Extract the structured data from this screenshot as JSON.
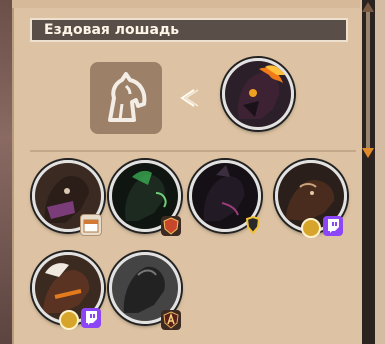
{
  "panel": {
    "title": "Ездовая лошадь"
  },
  "featured": {
    "icon": "horse-head-icon",
    "selected_mount": "fire-mane-horse"
  },
  "mounts": [
    {
      "id": "dark-horse-purple-saddle",
      "badge": "calendar-icon"
    },
    {
      "id": "spectral-green-horse",
      "badge": "shield-icon"
    },
    {
      "id": "black-horned-horse",
      "badge": "gold-emblem-icon"
    },
    {
      "id": "brown-stallion",
      "badge": "twitch-icon"
    },
    {
      "id": "armored-white-mane-horse",
      "badge": "twitch-icon"
    },
    {
      "id": "shadow-horse",
      "badge": "rank-a-icon"
    }
  ],
  "colors": {
    "panel_bg": "#ddc3a3",
    "title_bg": "#5a4e49",
    "accent_orange": "#e37a1e",
    "twitch": "#8c45f7"
  }
}
